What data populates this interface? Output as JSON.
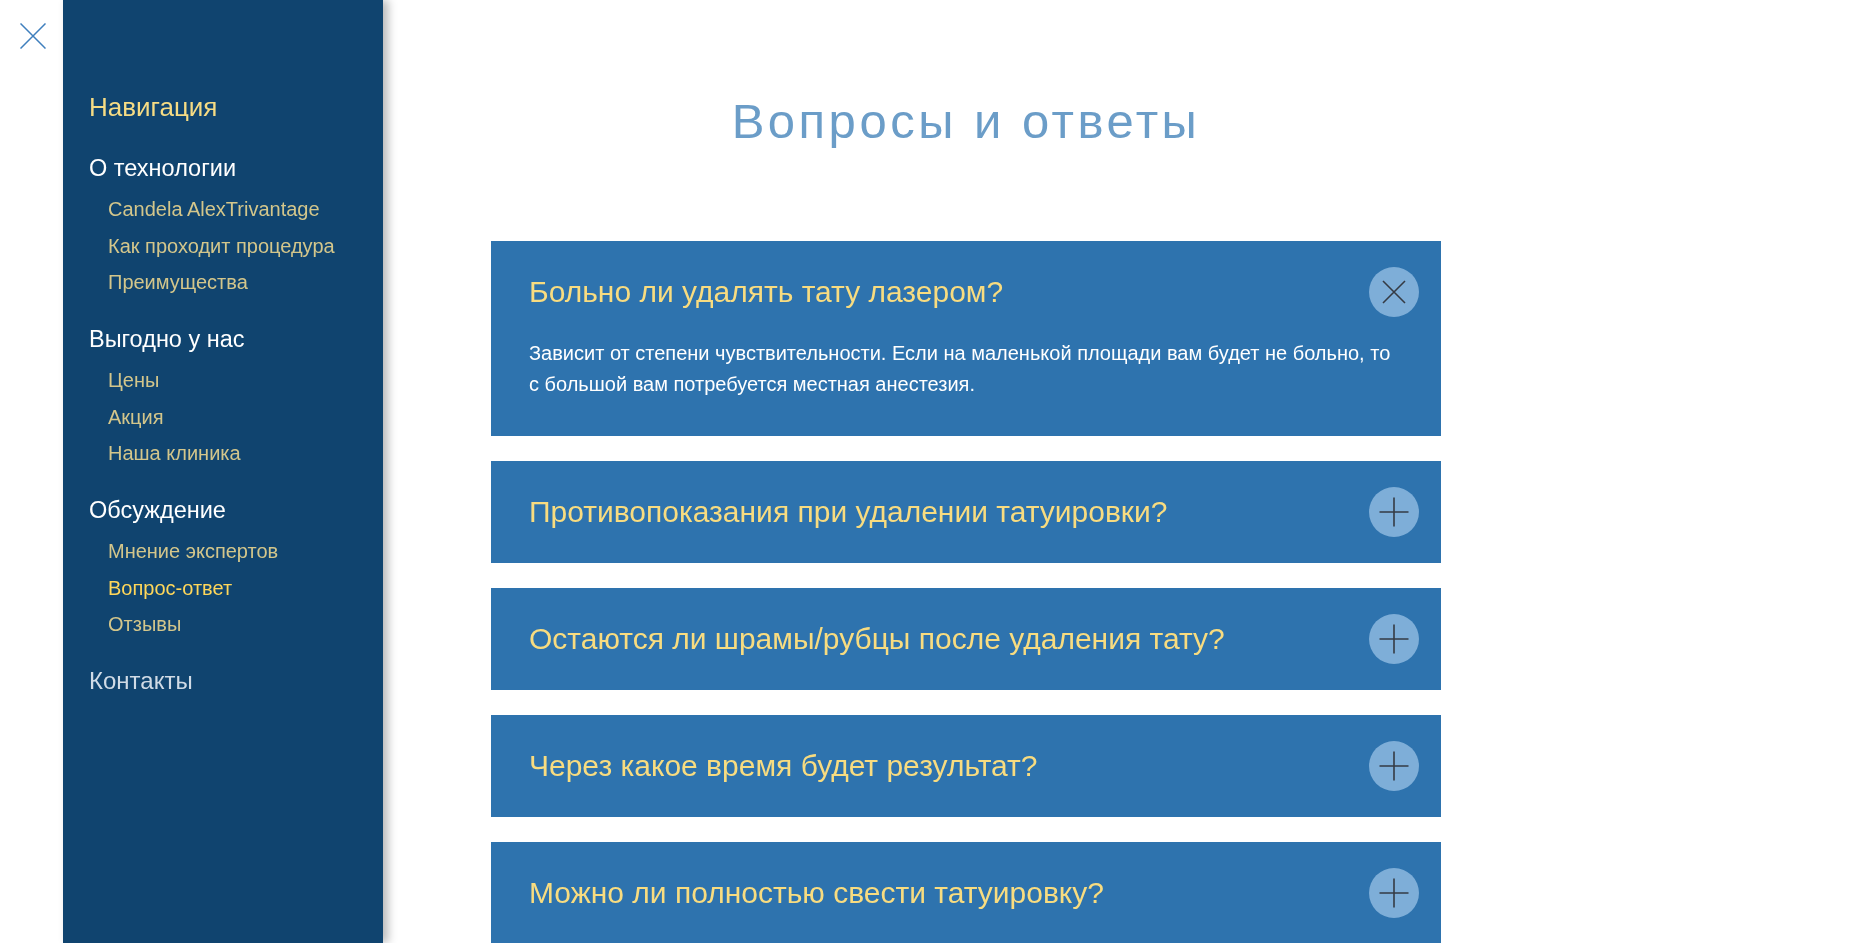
{
  "sidebar": {
    "title": "Навигация",
    "sections": [
      {
        "label": "О технологии",
        "kind": "heading",
        "items": [
          {
            "label": "Candela AlexTrivantage",
            "selected": false
          },
          {
            "label": "Как проходит процедура",
            "selected": false
          },
          {
            "label": "Преимущества",
            "selected": false
          }
        ]
      },
      {
        "label": "Выгодно у нас",
        "kind": "heading",
        "items": [
          {
            "label": "Цены",
            "selected": false
          },
          {
            "label": "Акция",
            "selected": false
          },
          {
            "label": "Наша клиника",
            "selected": false
          }
        ]
      },
      {
        "label": "Обсуждение",
        "kind": "heading",
        "items": [
          {
            "label": "Мнение экспертов",
            "selected": false
          },
          {
            "label": "Вопрос-ответ",
            "selected": true
          },
          {
            "label": "Отзывы",
            "selected": false
          }
        ]
      },
      {
        "label": "Контакты",
        "kind": "link"
      }
    ]
  },
  "page": {
    "title": "Вопросы и ответы"
  },
  "faq": [
    {
      "question": "Больно ли удалять тату лазером?",
      "expanded": true,
      "answer": "Зависит от степени чувствительности. Если на маленькой площади вам будет не больно, то с большой вам потребуется местная анестезия."
    },
    {
      "question": "Противопоказания при удалении татуировки?",
      "expanded": false
    },
    {
      "question": "Остаются ли шрамы/рубцы после удаления тату?",
      "expanded": false
    },
    {
      "question": "Через какое время будет результат?",
      "expanded": false
    },
    {
      "question": "Можно ли полностью свести татуировку?",
      "expanded": false
    }
  ]
}
